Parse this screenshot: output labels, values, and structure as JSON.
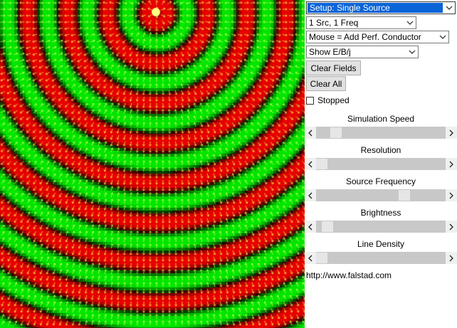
{
  "setup_select": {
    "value": "Setup: Single Source"
  },
  "source_select": {
    "value": "1 Src, 1 Freq"
  },
  "mouse_select": {
    "value": "Mouse = Add Perf. Conductor"
  },
  "show_select": {
    "value": "Show E/B/j"
  },
  "buttons": {
    "clear_fields": "Clear Fields",
    "clear_all": "Clear All"
  },
  "stopped_checkbox": {
    "label": "Stopped",
    "checked": false
  },
  "sliders": [
    {
      "label": "Simulation Speed",
      "level": 0.12
    },
    {
      "label": "Resolution",
      "level": 0.0
    },
    {
      "label": "Source Frequency",
      "level": 0.7
    },
    {
      "label": "Brightness",
      "level": 0.05
    },
    {
      "label": "Line Density",
      "level": 0.0
    }
  ],
  "url": "http://www.falstad.com",
  "colors": {
    "field_positive": "#c80000",
    "field_negative": "#00b400",
    "arrow": "#ffff50",
    "source": "#ffff80",
    "select_highlight": "#0a64d8"
  },
  "icons": {
    "dropdown": "chevron-down-icon",
    "scroll_left": "chevron-left-icon",
    "scroll_right": "chevron-right-icon"
  }
}
